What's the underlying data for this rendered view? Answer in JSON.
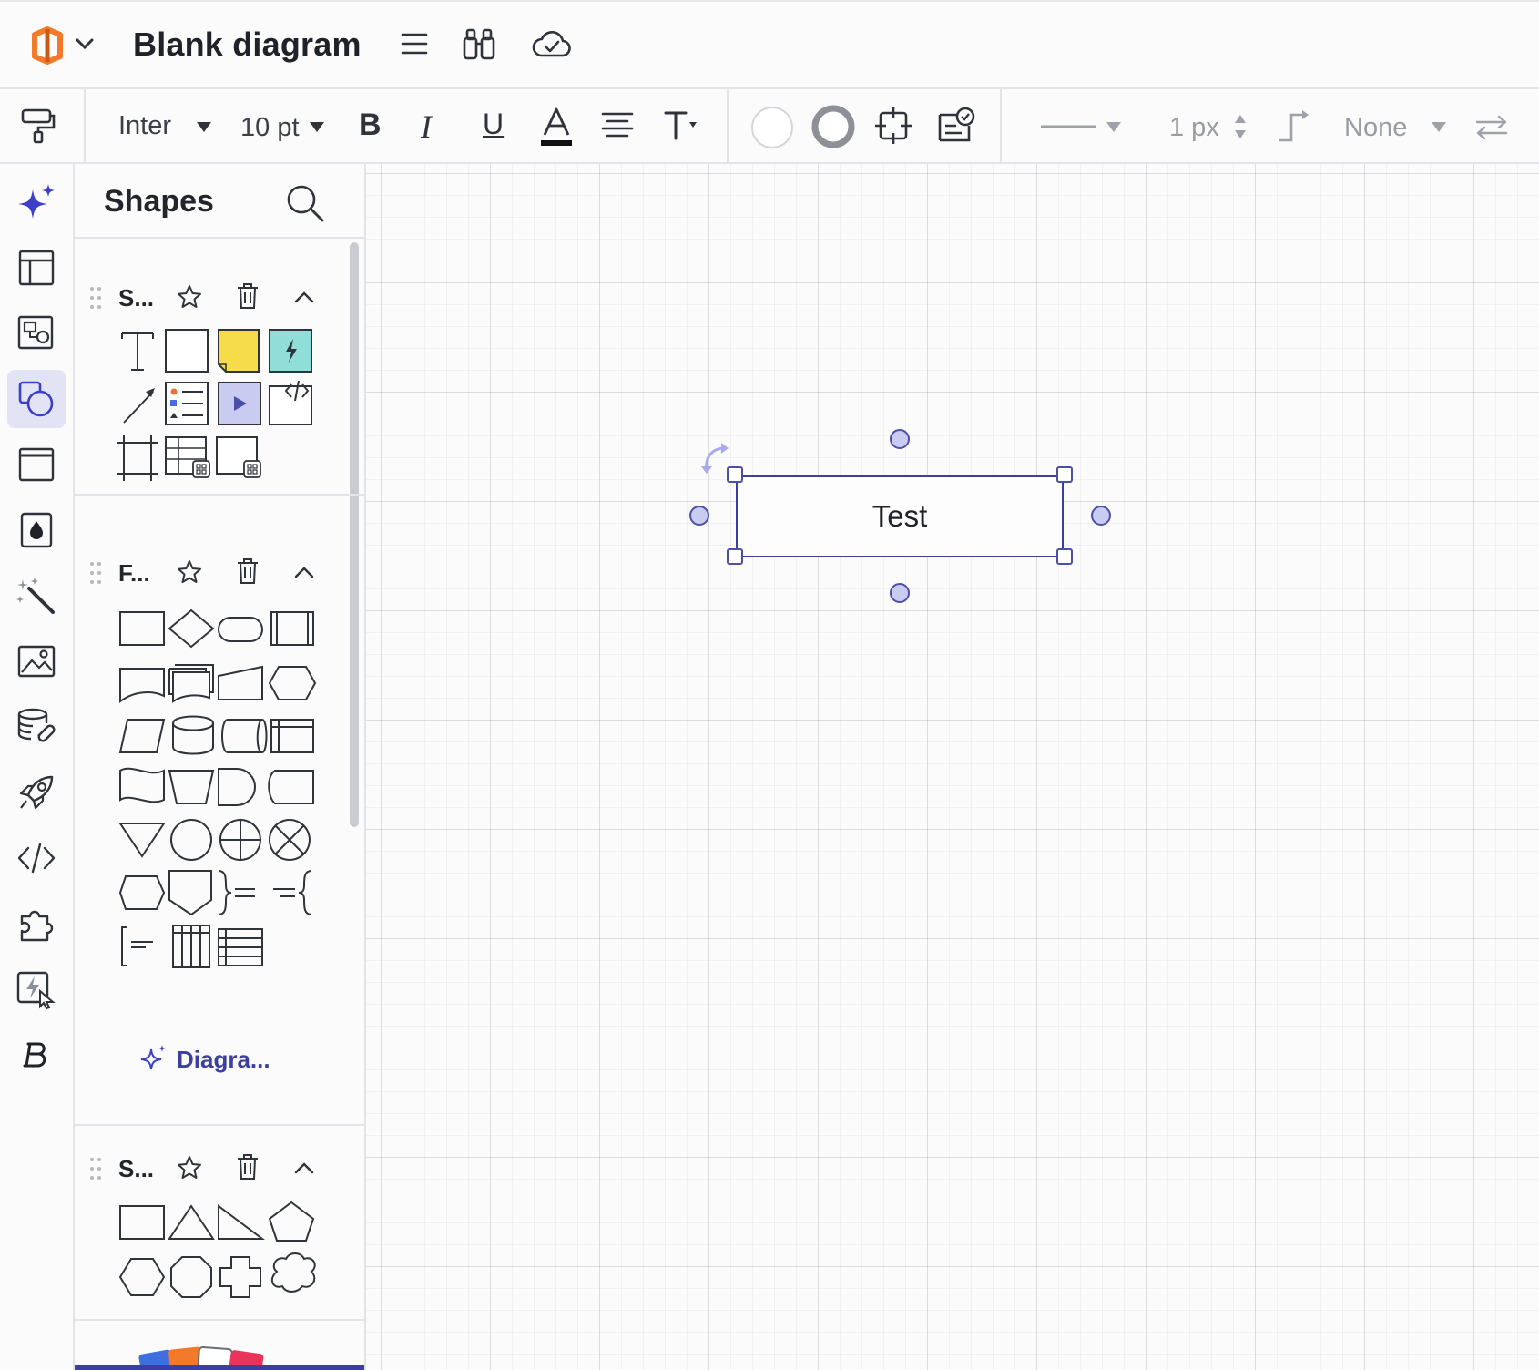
{
  "header": {
    "title": "Blank diagram"
  },
  "toolbar": {
    "font": "Inter",
    "font_size": "10 pt",
    "line_width": "1 px",
    "endpoint": "None"
  },
  "rail": {
    "items": [
      "ai-assistant",
      "page-layout",
      "templates",
      "shapes",
      "frame",
      "theme-colors",
      "magic-tools",
      "image",
      "data-linking",
      "rocket-launch",
      "code",
      "integrations",
      "automation",
      "brand"
    ],
    "active": "shapes"
  },
  "panel": {
    "title": "Shapes",
    "sections": [
      {
        "title": "S..."
      },
      {
        "title": "F..."
      },
      {
        "title": "S..."
      }
    ],
    "diagram_link": "Diagra..."
  },
  "canvas": {
    "shape_text": "Test"
  },
  "colors": {
    "accent": "#3d4098",
    "sticky_yellow": "#f7dc4a",
    "teal": "#8fded8",
    "selection_fill": "#c9cbf1",
    "brand_orange": "#f27a2a"
  }
}
